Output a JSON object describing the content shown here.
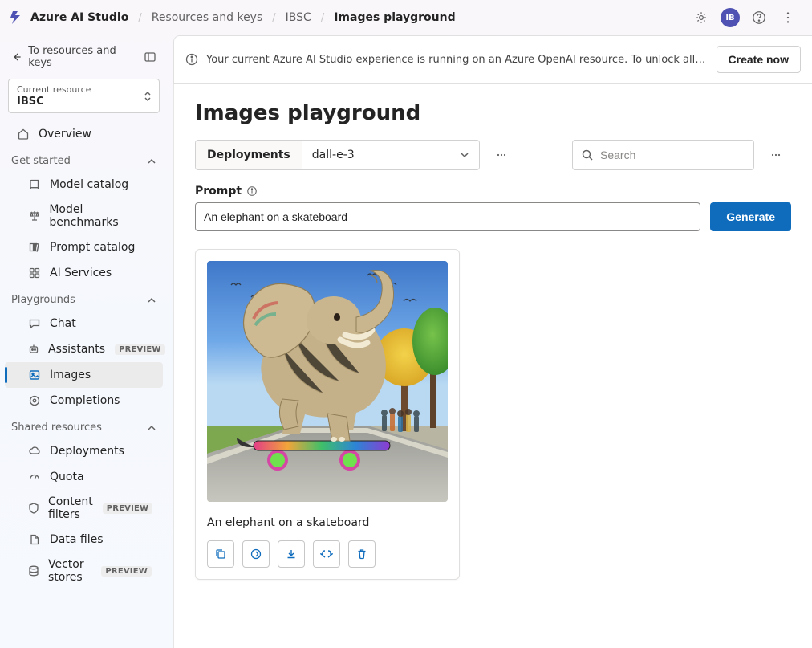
{
  "breadcrumb": {
    "brand": "Azure AI Studio",
    "items": [
      "Resources and keys",
      "IBSC"
    ],
    "current": "Images playground"
  },
  "topbar": {
    "avatar_initials": "IB"
  },
  "sidebar": {
    "back_label": "To resources and keys",
    "resource_label": "Current resource",
    "resource_value": "IBSC",
    "overview": "Overview",
    "sections": [
      {
        "title": "Get started",
        "items": [
          {
            "label": "Model catalog"
          },
          {
            "label": "Model benchmarks"
          },
          {
            "label": "Prompt catalog"
          },
          {
            "label": "AI Services"
          }
        ]
      },
      {
        "title": "Playgrounds",
        "items": [
          {
            "label": "Chat"
          },
          {
            "label": "Assistants",
            "badge": "PREVIEW"
          },
          {
            "label": "Images",
            "active": true
          },
          {
            "label": "Completions"
          }
        ]
      },
      {
        "title": "Shared resources",
        "items": [
          {
            "label": "Deployments"
          },
          {
            "label": "Quota"
          },
          {
            "label": "Content filters",
            "badge": "PREVIEW"
          },
          {
            "label": "Data files"
          },
          {
            "label": "Vector stores",
            "badge": "PREVIEW"
          }
        ]
      }
    ]
  },
  "banner": {
    "message": "Your current Azure AI Studio experience is running on an Azure OpenAI resource. To unlock all capabilities, create a...",
    "action": "Create now"
  },
  "page": {
    "title": "Images playground",
    "deployments_label": "Deployments",
    "deployment_value": "dall-e-3",
    "search_placeholder": "Search",
    "prompt_label": "Prompt",
    "prompt_value": "An elephant on a skateboard",
    "generate_label": "Generate",
    "result_caption": "An elephant on a skateboard"
  }
}
